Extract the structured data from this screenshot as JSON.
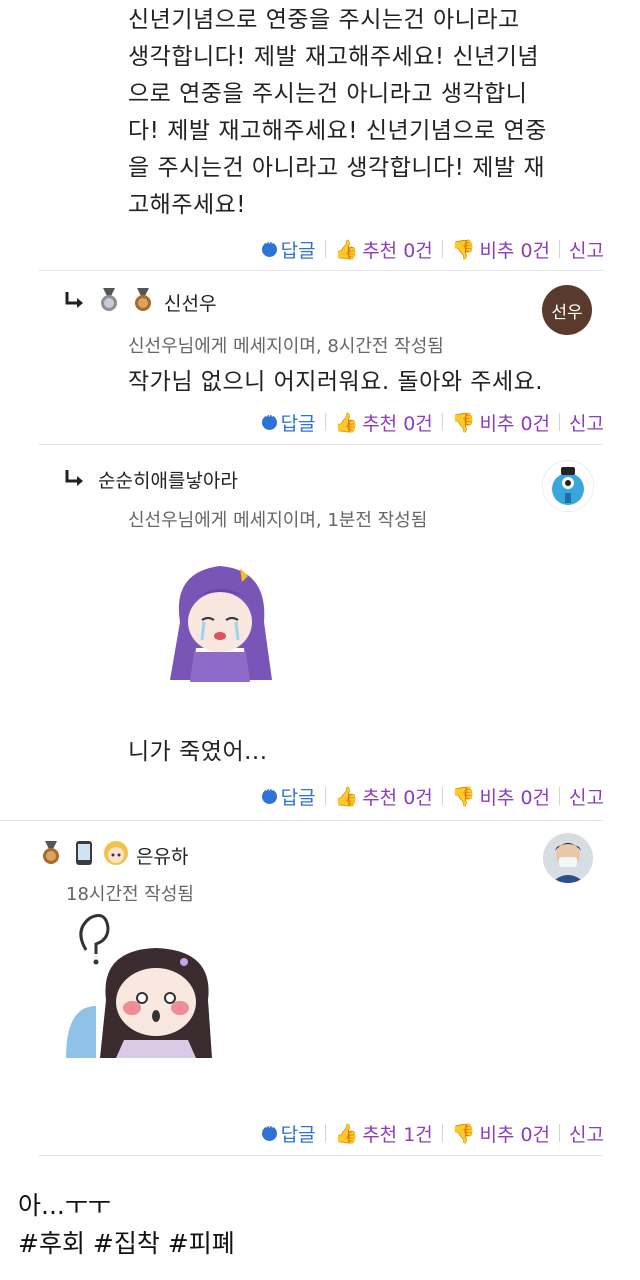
{
  "comments": [
    {
      "body_lines": [
        "신년기념으로 연중을 주시는건 아니라고",
        "생각합니다! 제발 재고해주세요! 신년기념",
        "으로 연중을 주시는건 아니라고 생각합니",
        "다! 제발 재고해주세요! 신년기념으로 연중",
        "을 주시는건 아니라고 생각합니다! 제발 재",
        "고해주세요!"
      ],
      "actions": {
        "reply": "답글",
        "up": "추천 0건",
        "down": "비추 0건",
        "report": "신고"
      }
    },
    {
      "username": "신선우",
      "avatar_text": "선우",
      "meta": "신선우님에게 메세지이며, 8시간전 작성됨",
      "body": "작가님 없으니 어지러워요. 돌아와 주세요.",
      "actions": {
        "reply": "답글",
        "up": "추천 0건",
        "down": "비추 0건",
        "report": "신고"
      }
    },
    {
      "username": "순순히애를낳아라",
      "meta": "신선우님에게 메세지이며, 1분전 작성됨",
      "body": "니가 죽였어...",
      "actions": {
        "reply": "답글",
        "up": "추천 0건",
        "down": "비추 0건",
        "report": "신고"
      }
    },
    {
      "username": "은유하",
      "meta": "18시간전 작성됨",
      "actions": {
        "reply": "답글",
        "up": "추천 1건",
        "down": "비추 0건",
        "report": "신고"
      }
    }
  ],
  "caption": {
    "line1": "아...ㅜㅜ",
    "line2": "#후회 #집착 #피폐"
  },
  "colors": {
    "reply": "#2f72d6",
    "vote": "#8e3cc1",
    "avatar_brown": "#5b3a2e"
  }
}
